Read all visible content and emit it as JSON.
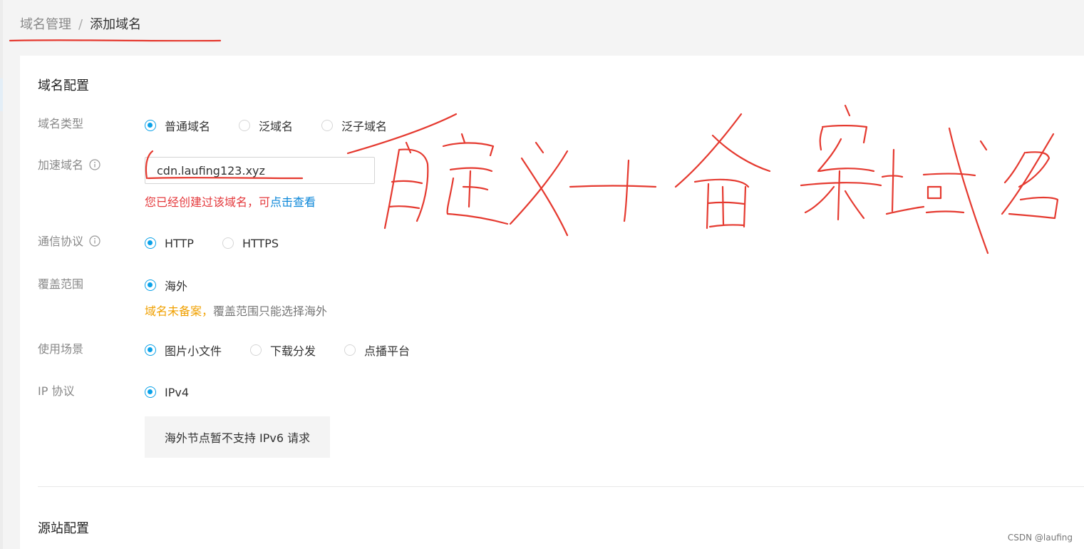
{
  "breadcrumb": {
    "parent": "域名管理",
    "separator": "/",
    "current": "添加域名"
  },
  "domain_config": {
    "title": "域名配置",
    "domain_type": {
      "label": "域名类型",
      "options": [
        "普通域名",
        "泛域名",
        "泛子域名"
      ],
      "selected": "普通域名"
    },
    "accel_domain": {
      "label": "加速域名",
      "value": "cdn.laufing123.xyz",
      "error_text": "您已经创建过该域名，可",
      "error_link": "点击查看"
    },
    "protocol": {
      "label": "通信协议",
      "options": [
        "HTTP",
        "HTTPS"
      ],
      "selected": "HTTP"
    },
    "coverage": {
      "label": "覆盖范围",
      "options": [
        "海外"
      ],
      "selected": "海外",
      "note_highlight": "域名未备案，",
      "note_rest": "覆盖范围只能选择海外"
    },
    "scenario": {
      "label": "使用场景",
      "options": [
        "图片小文件",
        "下载分发",
        "点播平台"
      ],
      "selected": "图片小文件"
    },
    "ip_protocol": {
      "label": "IP 协议",
      "options": [
        "IPv4"
      ],
      "selected": "IPv4",
      "notice": "海外节点暂不支持 IPv6 请求"
    }
  },
  "origin_config": {
    "title": "源站配置"
  },
  "watermark": "CSDN @laufing",
  "annotation": {
    "handwriting": "自定义+备案域名",
    "color": "#e53a30"
  },
  "colors": {
    "accent": "#0aa1e8",
    "error": "#e4393c",
    "link": "#0a86d8",
    "warning": "#f0a000"
  }
}
